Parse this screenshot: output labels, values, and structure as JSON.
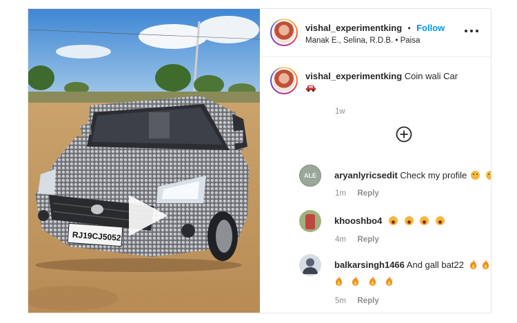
{
  "post": {
    "username": "vishal_experimentking",
    "separator": "•",
    "follow_label": "Follow",
    "audio": "Manak E., Selina, R.D.B. • Paisa",
    "caption_user": "vishal_experimentking",
    "caption_text": "Coin wali Car",
    "caption_time": "1w",
    "plate": "RJ19CJ5052"
  },
  "comments": [
    {
      "user": "aryanlyricsedit",
      "text": "Check my profile",
      "emojis": [
        "sad-emoji",
        "sad-emoji"
      ],
      "time": "1m",
      "reply_label": "Reply",
      "avatar_label": "ALE"
    },
    {
      "user": "khooshbo4",
      "text": "",
      "emojis": [
        "shocked-emoji",
        "shocked-emoji",
        "shocked-emoji",
        "shocked-emoji"
      ],
      "time": "4m",
      "reply_label": "Reply"
    },
    {
      "user": "balkarsingh1466",
      "text": "And gall bat22",
      "emojis": [
        "fire-emoji",
        "fire-emoji",
        "fire-emoji",
        "fire-emoji",
        "fire-emoji",
        "fire-emoji"
      ],
      "time": "5m",
      "reply_label": "Reply"
    }
  ],
  "icons": {
    "more": "more-options-icon",
    "add": "add-circle-icon",
    "play": "play-icon"
  },
  "colors": {
    "accent": "#0095f6",
    "muted": "#8e8e8e",
    "text": "#262626"
  }
}
